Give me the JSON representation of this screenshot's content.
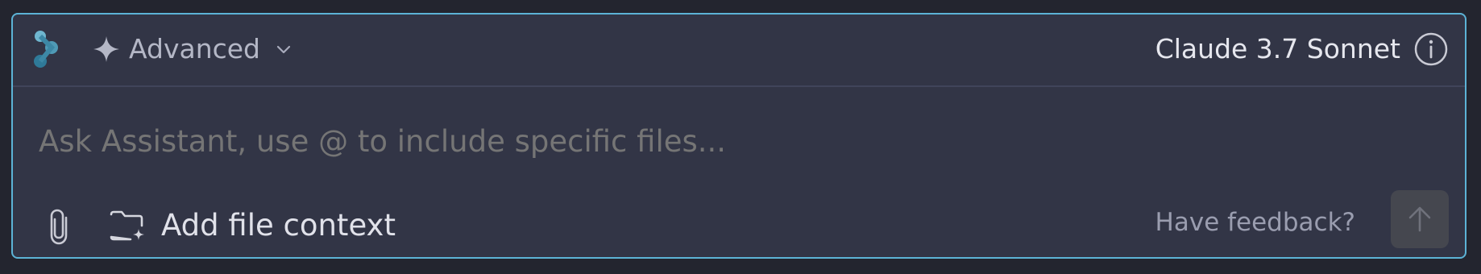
{
  "header": {
    "mode_label": "Advanced",
    "model_name": "Claude 3.7 Sonnet"
  },
  "input": {
    "placeholder": "Ask Assistant, use @ to include specific files..."
  },
  "footer": {
    "add_context_label": "Add file context",
    "feedback_label": "Have feedback?"
  },
  "icons": {
    "logo": "assistant-logo-icon",
    "mode": "sparkle-icon",
    "dropdown": "chevron-down-icon",
    "info": "info-icon",
    "attach": "paperclip-icon",
    "folder": "folder-add-icon",
    "send": "arrow-up-icon"
  },
  "colors": {
    "background": "#23252f",
    "panel": "#323546",
    "border_accent": "#5cb3d6",
    "send_button": "#45474f"
  }
}
